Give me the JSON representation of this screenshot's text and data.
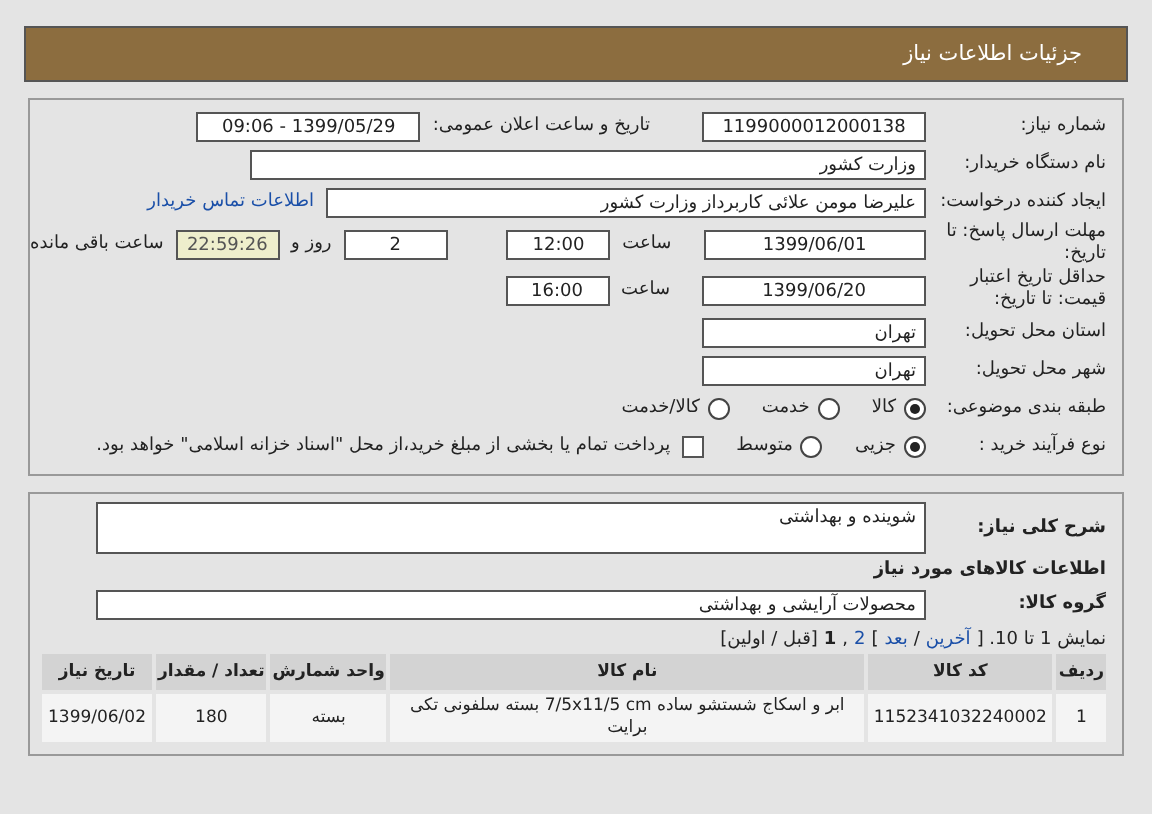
{
  "header": {
    "title": "جزئیات اطلاعات نیاز"
  },
  "need_number": {
    "label": "شماره نیاز:",
    "value": "1199000012000138"
  },
  "announce": {
    "label": "تاریخ و ساعت اعلان عمومی:",
    "value": "1399/05/29 - 09:06"
  },
  "buyer": {
    "label": "نام دستگاه خریدار:",
    "value": "وزارت کشور"
  },
  "creator": {
    "label": "ایجاد کننده درخواست:",
    "value": "علیرضا مومن علائی کاربرداز وزارت کشور",
    "link": "اطلاعات تماس خریدار"
  },
  "deadline": {
    "label": "مهلت ارسال پاسخ: تا تاریخ:",
    "date": "1399/06/01",
    "time_label": "ساعت",
    "time": "12:00",
    "days": "2",
    "days_label": "روز و",
    "remaining": "22:59:26",
    "remaining_label": "ساعت باقی مانده"
  },
  "validity": {
    "label": "حداقل تاریخ اعتبار قیمت: تا تاریخ:",
    "date": "1399/06/20",
    "time_label": "ساعت",
    "time": "16:00"
  },
  "province": {
    "label": "استان محل تحویل:",
    "value": "تهران"
  },
  "city": {
    "label": "شهر محل تحویل:",
    "value": "تهران"
  },
  "category": {
    "label": "طبقه بندی موضوعی:",
    "options": [
      {
        "label": "کالا",
        "selected": true
      },
      {
        "label": "خدمت",
        "selected": false
      },
      {
        "label": "کالا/خدمت",
        "selected": false
      }
    ]
  },
  "process": {
    "label": "نوع فرآیند خرید :",
    "options": [
      {
        "label": "جزیی",
        "selected": true
      },
      {
        "label": "متوسط",
        "selected": false
      }
    ],
    "treasury": {
      "label": "پرداخت تمام یا بخشی از مبلغ خرید،از محل \"اسناد خزانه اسلامی\" خواهد بود.",
      "checked": false
    }
  },
  "description": {
    "label": "شرح کلی نیاز:",
    "value": "شوینده و بهداشتی"
  },
  "goods_heading": "اطلاعات کالاهای مورد نیاز",
  "goods_group": {
    "label": "گروه کالا:",
    "value": "محصولات آرایشی و بهداشتی"
  },
  "pager": [
    {
      "kind": "text",
      "text": "نمایش 1 تا 10. ["
    },
    {
      "kind": "link",
      "text": "آخرین"
    },
    {
      "kind": "text",
      "text": "/"
    },
    {
      "kind": "link",
      "text": "بعد"
    },
    {
      "kind": "text",
      "text": "]"
    },
    {
      "kind": "link",
      "text": "2"
    },
    {
      "kind": "text",
      "text": ","
    },
    {
      "kind": "current",
      "text": "1"
    },
    {
      "kind": "text",
      "text": "[قبل / اولین]"
    }
  ],
  "table": {
    "columns": [
      "ردیف",
      "کد کالا",
      "نام کالا",
      "واحد شمارش",
      "تعداد / مقدار",
      "تاریخ نیاز"
    ],
    "rows": [
      [
        "1",
        "1152341032240002",
        "ابر و اسکاج شستشو ساده 7/5x11/5 cm بسته سلفونی تکی برایت",
        "بسته",
        "180",
        "1399/06/02"
      ]
    ]
  }
}
